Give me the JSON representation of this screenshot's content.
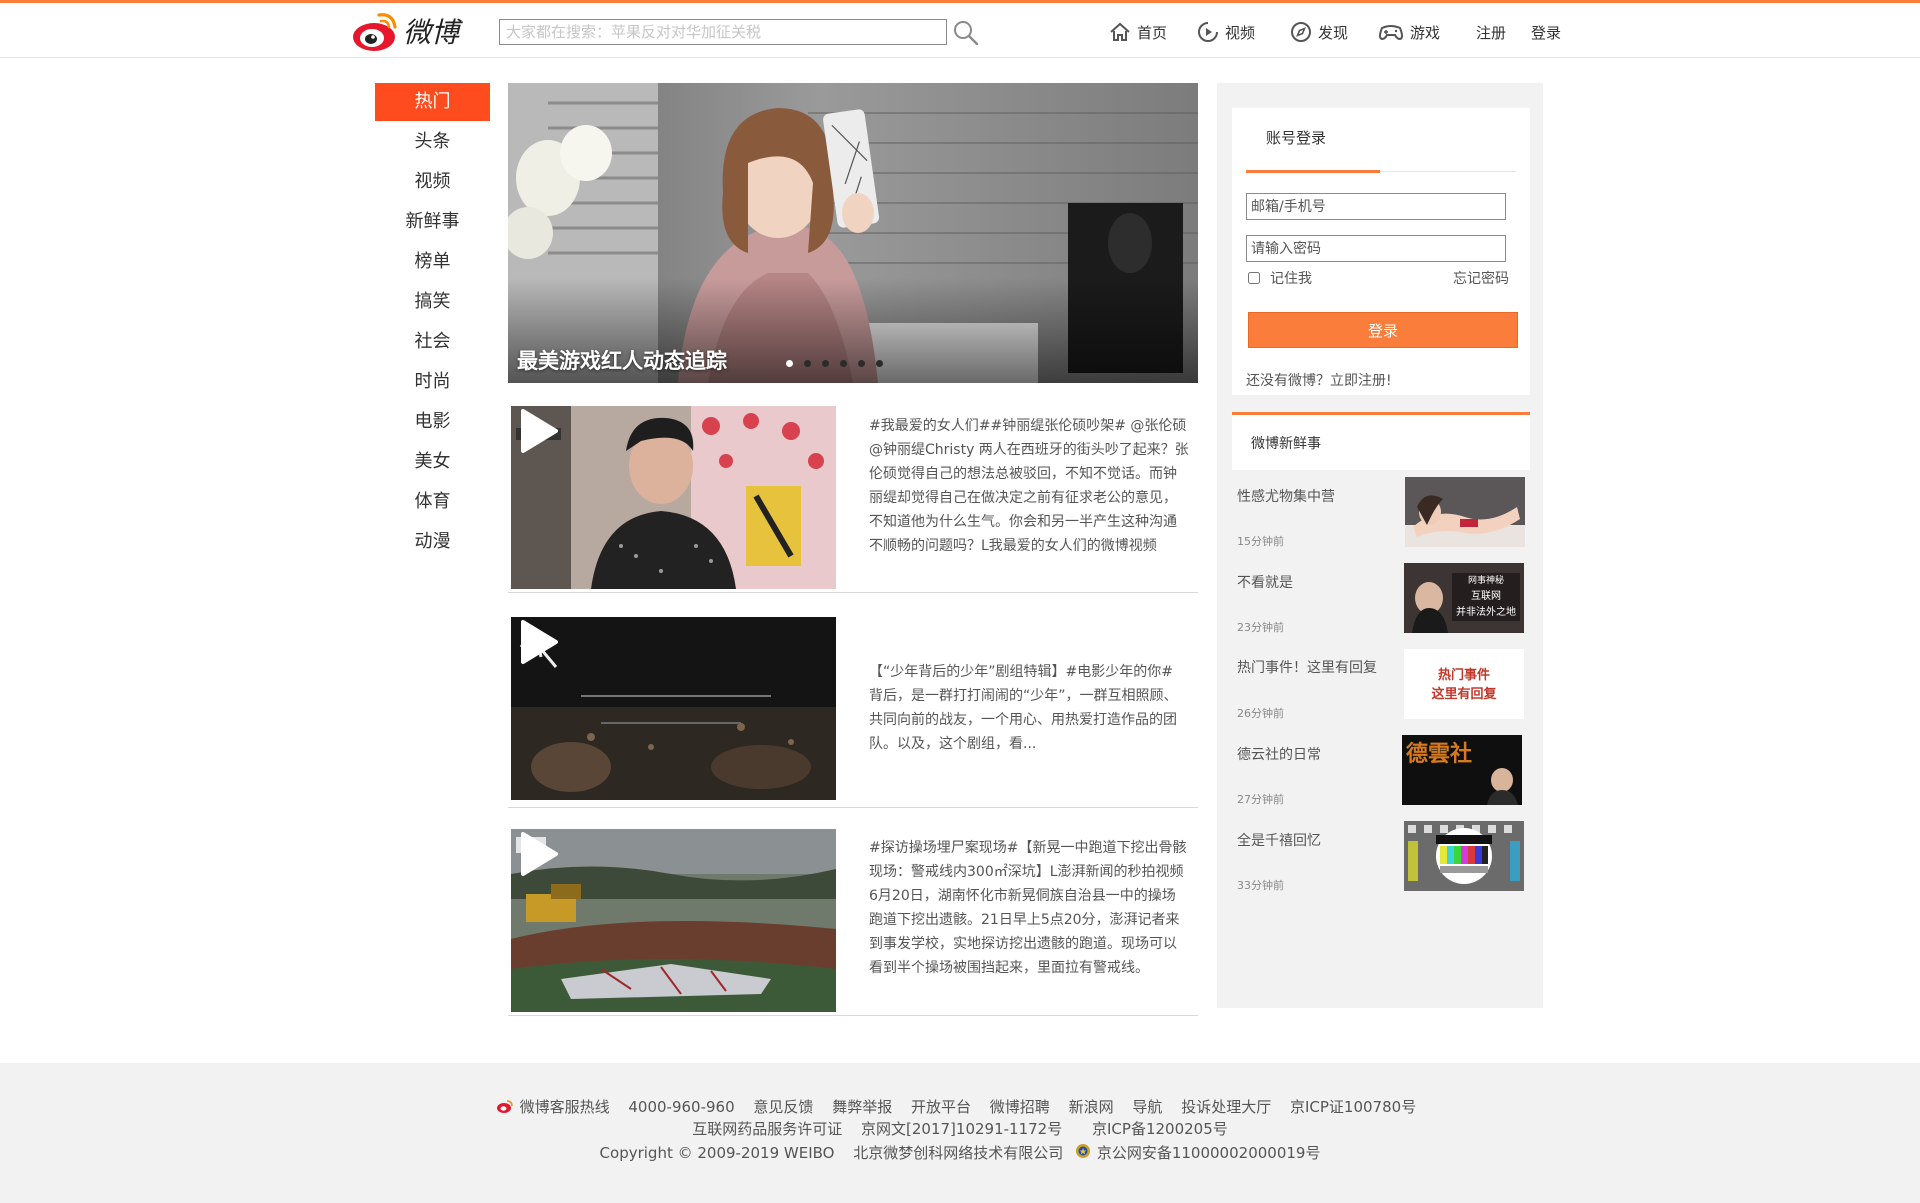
{
  "header": {
    "logo_text": "微博",
    "search_placeholder": "大家都在搜索：苹果反对对华加征关税",
    "nav": [
      {
        "label": "首页",
        "icon": "home-icon"
      },
      {
        "label": "视频",
        "icon": "video-icon"
      },
      {
        "label": "发现",
        "icon": "compass-icon"
      },
      {
        "label": "游戏",
        "icon": "gamepad-icon"
      },
      {
        "label": "注册"
      },
      {
        "label": "登录"
      }
    ]
  },
  "channels": [
    "热门",
    "头条",
    "视频",
    "新鲜事",
    "榜单",
    "搞笑",
    "社会",
    "时尚",
    "电影",
    "美女",
    "体育",
    "动漫"
  ],
  "banner": {
    "caption": "最美游戏红人动态追踪",
    "dot_count": 6,
    "active_dot": 0
  },
  "feed": [
    {
      "text": "#我最爱的女人们##钟丽缇张伦硕吵架# @张伦硕 @钟丽缇Christy 两人在西班牙的街头吵了起来？张伦硕觉得自己的想法总被驳回，不知不觉话。而钟丽缇却觉得自己在做决定之前有征求老公的意见，不知道他为什么生气。你会和另一半产生这种沟通不顺畅的问题吗？L我最爱的女人们的微博视频"
    },
    {
      "text": "【“少年背后的少年”剧组特辑】#电影少年的你# 背后，是一群打打闹闹的“少年”，一群互相照顾、共同向前的战友，一个用心、用热爱打造作品的团队。以及，这个剧组，看..."
    },
    {
      "text": "#探访操场埋尸案现场#【新晃一中跑道下挖出骨骸现场：警戒线内300㎡深坑】L澎湃新闻的秒拍视频 6月20日，湖南怀化市新晃侗族自治县一中的操场跑道下挖出遗骸。21日早上5点20分，澎湃记者来到事发学校，实地探访挖出遗骸的跑道。现场可以看到半个操场被围挡起来，里面拉有警戒线。"
    }
  ],
  "login": {
    "tab_label": "账号登录",
    "username_placeholder": "邮箱/手机号",
    "password_placeholder": "请输入密码",
    "remember_label": "记住我",
    "forgot_label": "忘记密码",
    "submit_label": "登录",
    "signup_text": "还没有微博？立即注册!"
  },
  "news": {
    "heading": "微博新鲜事",
    "items": [
      {
        "title": "性感尤物集中营",
        "time": "15分钟前"
      },
      {
        "title": "不看就是",
        "time": "23分钟前",
        "thumb_text": "网事神秘 互联网 并非法外之地"
      },
      {
        "title": "热门事件！这里有回复",
        "time": "26分钟前",
        "thumb_text": "热门事件 这里有回复"
      },
      {
        "title": "德云社的日常",
        "time": "27分钟前",
        "thumb_text": "德雲社"
      },
      {
        "title": "全是千禧回忆",
        "time": "33分钟前"
      }
    ]
  },
  "footer": {
    "row1": [
      "微博客服热线",
      "4000-960-960",
      "意见反馈",
      "舞弊举报",
      "开放平台",
      "微博招聘",
      "新浪网",
      "导航",
      "投诉处理大厅",
      "京ICP证100780号"
    ],
    "row2": [
      "互联网药品服务许可证",
      "京网文[2017]10291-1172号",
      "京ICP备1200205号"
    ],
    "row3": [
      "Copyright © 2009-2019 WEIBO",
      "北京微梦创科网络技术有限公司",
      "京公网安备11000002000019号"
    ]
  },
  "colors": {
    "accent": "#fa7d3c",
    "active_channel": "#ff4c1f",
    "sidebar_bg": "#f2f2f2"
  }
}
